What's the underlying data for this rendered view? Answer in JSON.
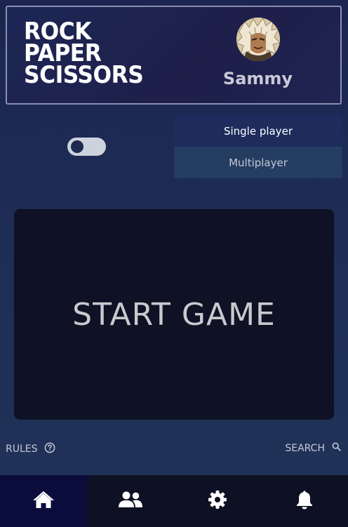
{
  "app": {
    "logo_lines": [
      "ROCK",
      "PAPER",
      "SCISSORS"
    ]
  },
  "user": {
    "name": "Sammy",
    "avatar_icon": "anime-character-avatar"
  },
  "toggle": {
    "state": "off",
    "icon": "toggle-switch"
  },
  "mode": {
    "options": [
      {
        "label": "Single player",
        "selected": true
      },
      {
        "label": "Multiplayer",
        "selected": false
      }
    ]
  },
  "start": {
    "label": "START GAME"
  },
  "footer": {
    "rules_label": "RULES",
    "rules_icon": "question-circle-icon",
    "search_label": "SEARCH",
    "search_icon": "search-icon"
  },
  "nav": {
    "items": [
      {
        "icon": "home-icon",
        "active": true
      },
      {
        "icon": "users-icon",
        "active": false
      },
      {
        "icon": "gear-icon",
        "active": false
      },
      {
        "icon": "bell-icon",
        "active": false
      }
    ]
  },
  "colors": {
    "background": "#1e2d56",
    "panel": "#0f1124",
    "nav_bar": "#0e1024",
    "nav_active": "#0a0d3c",
    "mode_active": "#1d2c5c",
    "mode_inactive": "#263d62",
    "text_light": "#c9c9cf"
  }
}
